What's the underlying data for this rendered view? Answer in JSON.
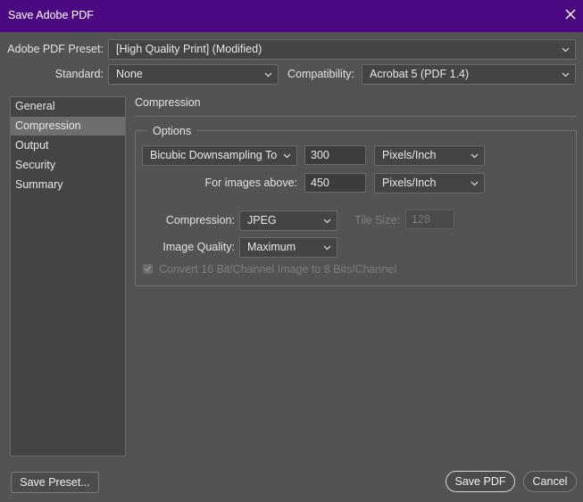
{
  "window": {
    "title": "Save Adobe PDF"
  },
  "preset": {
    "label": "Adobe PDF Preset:",
    "value": "[High Quality Print] (Modified)"
  },
  "standard": {
    "label": "Standard:",
    "value": "None"
  },
  "compatibility": {
    "label": "Compatibility:",
    "value": "Acrobat 5 (PDF 1.4)"
  },
  "sidebar": {
    "items": [
      {
        "label": "General",
        "selected": false
      },
      {
        "label": "Compression",
        "selected": true
      },
      {
        "label": "Output",
        "selected": false
      },
      {
        "label": "Security",
        "selected": false
      },
      {
        "label": "Summary",
        "selected": false
      }
    ]
  },
  "panel": {
    "title": "Compression",
    "options_legend": "Options",
    "downsampling": {
      "value": "Bicubic Downsampling To",
      "ppi": "300",
      "unit": "Pixels/Inch"
    },
    "images_above": {
      "label": "For images above:",
      "ppi": "450",
      "unit": "Pixels/Inch"
    },
    "compression": {
      "label": "Compression:",
      "value": "JPEG"
    },
    "tile_size": {
      "label": "Tile Size:",
      "value": "128"
    },
    "image_quality": {
      "label": "Image Quality:",
      "value": "Maximum"
    },
    "convert_16bit": {
      "label": "Convert 16 Bit/Channel Image to 8 Bits/Channel",
      "checked": true
    }
  },
  "buttons": {
    "save_preset": "Save Preset...",
    "save_pdf": "Save PDF",
    "cancel": "Cancel"
  },
  "colors": {
    "titlebar": "#4b0a82",
    "background": "#535353"
  }
}
